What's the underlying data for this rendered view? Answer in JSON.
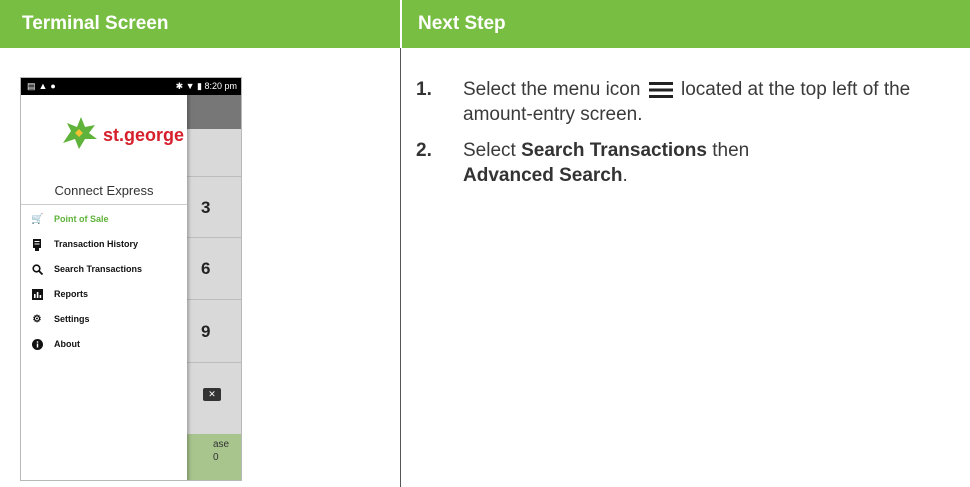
{
  "header": {
    "left_title": "Terminal Screen",
    "right_title": "Next Step"
  },
  "colors": {
    "header_green": "#78be43",
    "brand_red": "#d6202c",
    "active_green": "#5fb23a"
  },
  "phone": {
    "status_time": "8:20 pm",
    "brand": "st.george",
    "app_title": "Connect Express",
    "menu": [
      {
        "label": "Point of Sale",
        "icon": "cart-icon",
        "active": true
      },
      {
        "label": "Transaction History",
        "icon": "receipt-icon",
        "active": false
      },
      {
        "label": "Search Transactions",
        "icon": "search-icon",
        "active": false
      },
      {
        "label": "Reports",
        "icon": "bar-chart-icon",
        "active": false
      },
      {
        "label": "Settings",
        "icon": "gear-icon",
        "active": false
      },
      {
        "label": "About",
        "icon": "info-icon",
        "active": false
      }
    ],
    "background_keys": [
      "3",
      "6",
      "9"
    ],
    "background_button": {
      "line1": "ase",
      "line2": "0"
    }
  },
  "steps": [
    {
      "num": "1.",
      "pre": "Select the menu icon",
      "icon": "hamburger-menu-icon",
      "post": "located at the top left of the amount-entry screen."
    },
    {
      "num": "2.",
      "pre": "Select ",
      "bold1": "Search Transactions",
      "mid": " then ",
      "bold2": "Advanced Search",
      "post": "."
    }
  ]
}
